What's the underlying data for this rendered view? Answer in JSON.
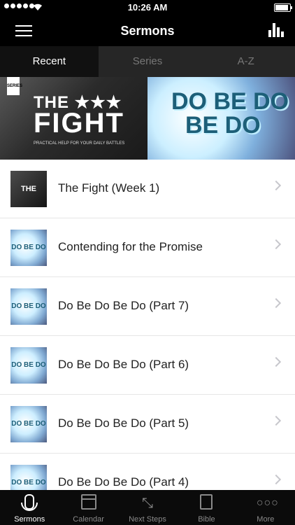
{
  "status_bar": {
    "time": "10:26 AM"
  },
  "nav": {
    "title": "Sermons",
    "menu_icon": "hamburger-menu-icon",
    "chart_icon": "bar-chart-icon"
  },
  "tabs": [
    {
      "label": "Recent",
      "active": true
    },
    {
      "label": "Series",
      "active": false
    },
    {
      "label": "A-Z",
      "active": false
    }
  ],
  "banner": {
    "left": {
      "badge": "SERIES",
      "line1": "THE ★★★",
      "line2": "FIGHT",
      "tagline": "PRACTICAL HELP FOR YOUR DAILY BATTLES"
    },
    "right": {
      "line1": "DO BE DO",
      "line2": "BE DO"
    }
  },
  "sermons": [
    {
      "title": "The Fight (Week 1)",
      "thumb_text": "THE FIGHT"
    },
    {
      "title": "Contending for the Promise",
      "thumb_text": "DO BE DO"
    },
    {
      "title": "Do Be Do Be Do (Part 7)",
      "thumb_text": "DO BE DO"
    },
    {
      "title": "Do Be Do Be Do (Part 6)",
      "thumb_text": "DO BE DO"
    },
    {
      "title": "Do Be Do Be Do (Part 5)",
      "thumb_text": "DO BE DO"
    },
    {
      "title": "Do Be Do Be Do (Part 4)",
      "thumb_text": "DO BE DO"
    }
  ],
  "tabbar": [
    {
      "label": "Sermons",
      "icon": "microphone-icon",
      "active": true
    },
    {
      "label": "Calendar",
      "icon": "calendar-icon",
      "active": false
    },
    {
      "label": "Next Steps",
      "icon": "arrows-icon",
      "active": false
    },
    {
      "label": "Bible",
      "icon": "book-icon",
      "active": false
    },
    {
      "label": "More",
      "icon": "more-dots-icon",
      "active": false
    }
  ]
}
